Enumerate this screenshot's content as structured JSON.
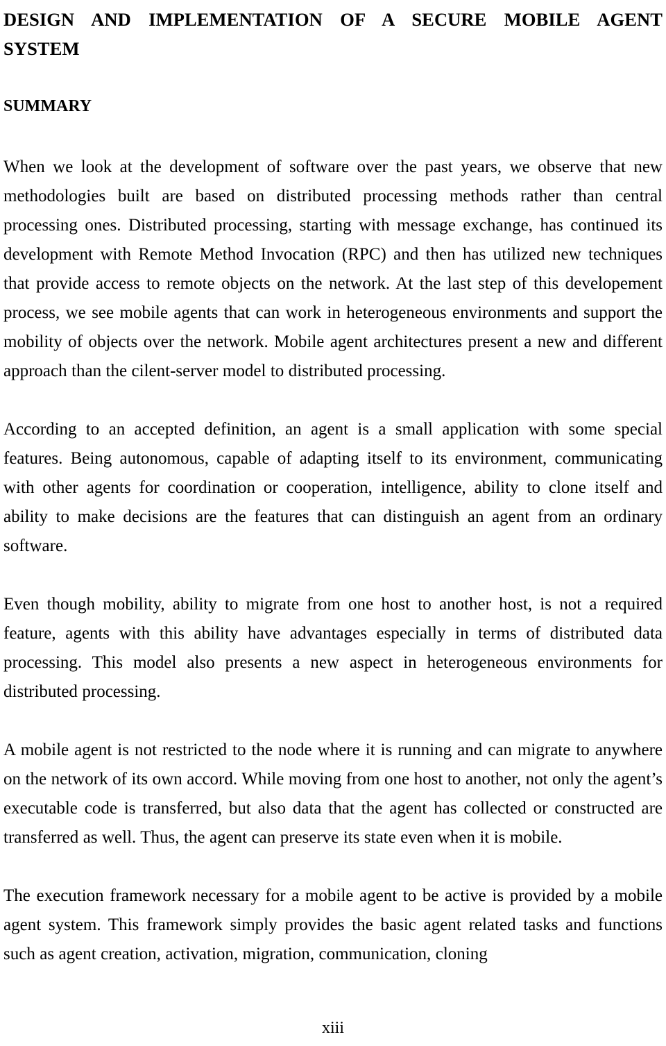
{
  "document": {
    "title_line1": "DESIGN AND IMPLEMENTATION OF A SECURE MOBILE AGENT",
    "title_line2": "SYSTEM",
    "section_heading": "SUMMARY",
    "page_number": "xiii",
    "paragraphs": [
      "When we look at the development of software over the past years, we  observe that new methodologies  built  are based on distributed processing methods rather than central processing ones. Distributed processing, starting with message exchange, has continued its development with Remote Method Invocation (RPC) and then has utilized new techniques that provide access to remote objects on the network. At the last step of this developement  process, we see mobile agents that can work in heterogeneous environments and support the mobility of objects over the network. Mobile agent architectures present a new and different approach than the cilent-server model to distributed processing.",
      "According to  an accepted definition, an agent is a small application with some special features. Being autonomous, capable of adapting itself to its environment, communicating with other agents for coordination or cooperation, intelligence, ability to clone itself and ability to make decisions are the features that can distinguish an agent from an ordinary software.",
      "Even though mobility, ability to migrate from one host to another host,  is not a required feature, agents with this ability have advantages especially in terms of distributed data processing. This model also presents a new aspect in heterogeneous environments for distributed processing.",
      "A mobile agent is not restricted to the node where it is running and can migrate to anywhere on the network of its own accord. While moving from one host to another, not only the agent’s executable code is transferred, but also data that the agent has collected or constructed are transferred as well. Thus, the agent can preserve its state even when it is mobile.",
      "The execution framework necessary for a mobile agent to be  active is provided by a mobile agent system. This framework simply provides the basic agent related tasks and functions such as agent creation, activation, migration, communication, cloning"
    ]
  }
}
